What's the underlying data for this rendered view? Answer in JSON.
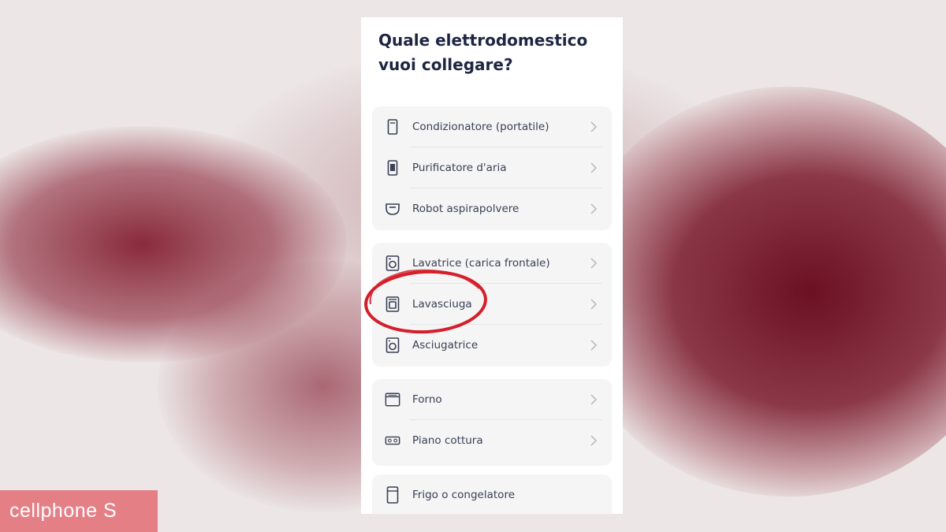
{
  "screen_title": "Quale elettrodomestico vuoi collegare?",
  "groups": [
    {
      "items": [
        {
          "label": "Condizionatore (portatile)",
          "icon": "portable-ac-icon"
        },
        {
          "label": "Purificatore d'aria",
          "icon": "air-purifier-icon"
        },
        {
          "label": "Robot aspirapolvere",
          "icon": "robot-vacuum-icon"
        }
      ]
    },
    {
      "items": [
        {
          "label": "Lavatrice (carica frontale)",
          "icon": "washing-machine-icon"
        },
        {
          "label": "Lavasciuga",
          "icon": "washer-dryer-icon",
          "highlighted": true
        },
        {
          "label": "Asciugatrice",
          "icon": "dryer-icon"
        }
      ]
    },
    {
      "items": [
        {
          "label": "Forno",
          "icon": "oven-icon"
        },
        {
          "label": "Piano cottura",
          "icon": "hob-icon"
        }
      ]
    },
    {
      "items": [
        {
          "label": "Frigo o congelatore",
          "icon": "fridge-icon"
        }
      ]
    }
  ],
  "watermark": "cellphone S",
  "colors": {
    "title": "#1d2541",
    "item_text": "#3a3f55",
    "highlight_circle": "#d41f2c",
    "background_smoke": "#7d0e22",
    "watermark_bg": "#e57f86"
  }
}
